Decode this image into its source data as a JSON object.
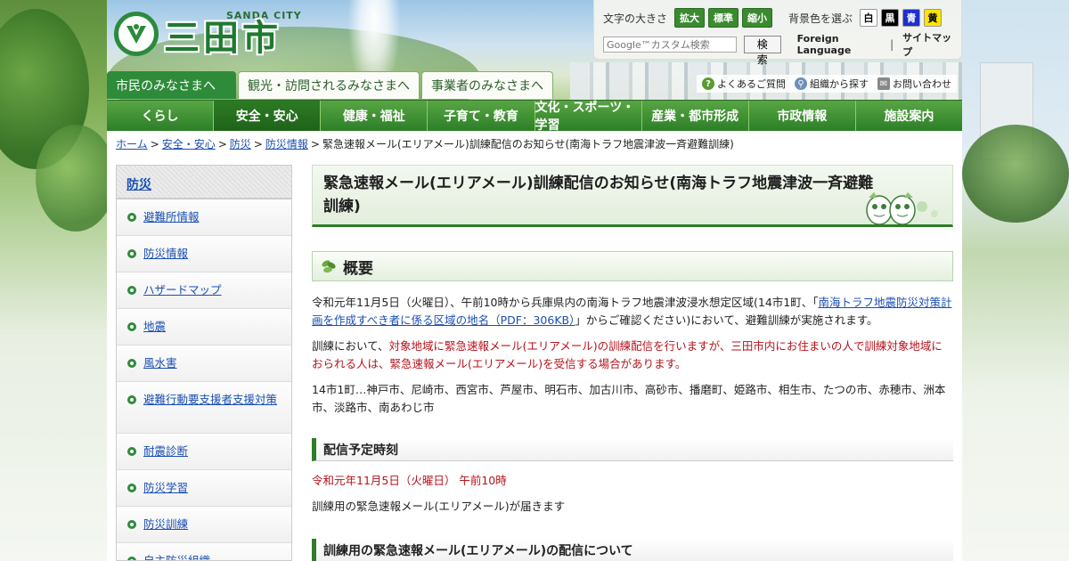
{
  "header": {
    "logo_en": "SANDA CITY",
    "logo_jp": "三田市",
    "font_size_label": "文字の大きさ",
    "font_buttons": [
      "拡大",
      "標準",
      "縮小"
    ],
    "bg_label": "背景色を選ぶ",
    "bg_buttons": [
      "白",
      "黒",
      "青",
      "黄"
    ],
    "search_placeholder": "Google™カスタム検索",
    "search_button": "検 索",
    "foreign_language": "Foreign Language",
    "sep": "|",
    "sitemap": "サイトマップ"
  },
  "audience_tabs": [
    "市民のみなさまへ",
    "観光・訪問されるみなさまへ",
    "事業者のみなさまへ"
  ],
  "quick_links": [
    "よくあるご質問",
    "組織から探す",
    "お問い合わせ"
  ],
  "nav": [
    "くらし",
    "安全・安心",
    "健康・福祉",
    "子育て・教育",
    "文化・スポーツ・学習",
    "産業・都市形成",
    "市政情報",
    "施設案内"
  ],
  "breadcrumb": {
    "items": [
      "ホーム",
      "安全・安心",
      "防災",
      "防災情報"
    ],
    "current": "緊急速報メール(エリアメール)訓練配信のお知らせ(南海トラフ地震津波一斉避難訓練)"
  },
  "sidebar": {
    "heading": "防災",
    "items": [
      "避難所情報",
      "防災情報",
      "ハザードマップ",
      "地震",
      "風水害",
      "避難行動要支援者支援対策",
      "耐震診断",
      "防災学習",
      "防災訓練",
      "自主防災組織"
    ]
  },
  "main": {
    "title": "緊急速報メール(エリアメール)訓練配信のお知らせ(南海トラフ地震津波一斉避難訓練)",
    "section_overview": "概要",
    "p1_prefix": "令和元年11月5日（火曜日）、午前10時から兵庫県内の南海トラフ地震津波浸水想定区域(14市1町、「",
    "p1_link": "南海トラフ地震防災対策計画を作成すべき者に係る区域の地名（PDF：306KB）",
    "p1_suffix": "」からご確認ください)において、避難訓練が実施されます。",
    "p2_prefix": "訓練において、",
    "p2_red": "対象地域に緊急速報メール(エリアメール)の訓練配信を行いますが、三田市内にお住まいの人で訓練対象地域におられる人は、緊急速報メール(エリアメール)を受信する場合があります。",
    "p3": "14市1町…神戸市、尼崎市、西宮市、芦屋市、明石市、加古川市、高砂市、播磨町、姫路市、相生市、たつの市、赤穂市、洲本市、淡路市、南あわじ市",
    "h3_schedule": "配信予定時刻",
    "schedule_time": "令和元年11月5日（火曜日） 午前10時",
    "schedule_note": "訓練用の緊急速報メール(エリアメール)が届きます",
    "h3_about": "訓練用の緊急速報メール(エリアメール)の配信について"
  },
  "colors": {
    "brand_green": "#2e8b3a",
    "link_blue": "#1a4fb3",
    "alert_red": "#b5121b"
  }
}
